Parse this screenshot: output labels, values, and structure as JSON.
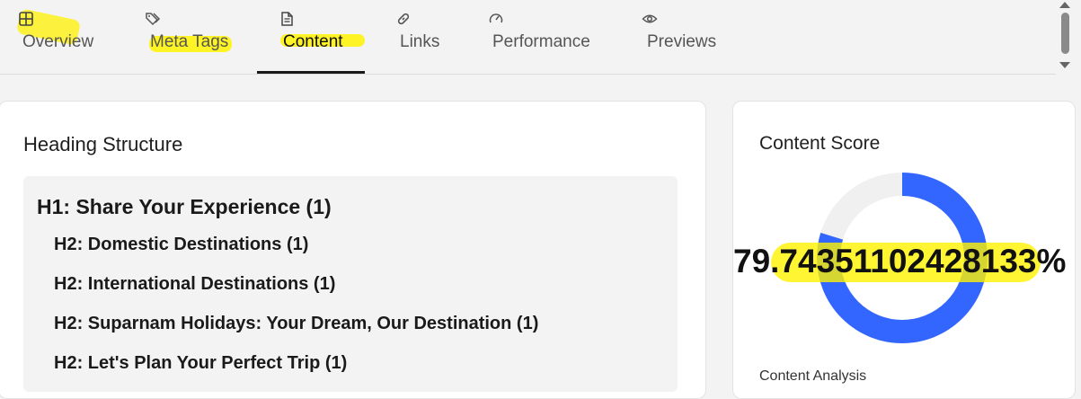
{
  "tabs": [
    {
      "label": "Overview",
      "icon": "grid-icon"
    },
    {
      "label": "Meta Tags",
      "icon": "tags-icon"
    },
    {
      "label": "Content",
      "icon": "document-icon",
      "active": true
    },
    {
      "label": "Links",
      "icon": "link-icon"
    },
    {
      "label": "Performance",
      "icon": "gauge-icon"
    },
    {
      "label": "Previews",
      "icon": "eye-icon"
    }
  ],
  "heading_structure": {
    "title": "Heading Structure",
    "items": [
      {
        "level": "H1",
        "text": "H1: Share Your Experience (1)"
      },
      {
        "level": "H2",
        "text": "H2: Domestic Destinations (1)"
      },
      {
        "level": "H2",
        "text": "H2: International Destinations (1)"
      },
      {
        "level": "H2",
        "text": "H2: Suparnam Holidays: Your Dream, Our Destination (1)"
      },
      {
        "level": "H2",
        "text": "H2: Let's Plan Your Perfect Trip (1)"
      }
    ]
  },
  "content_score": {
    "title": "Content Score",
    "value_text": "79.74351102428133%",
    "value": 79.74351102428133,
    "ring_color": "#3366ff",
    "track_color": "#f0f0f0",
    "analysis_label": "Content Analysis"
  },
  "colors": {
    "highlight": "#fff200",
    "accent": "#3366ff"
  }
}
